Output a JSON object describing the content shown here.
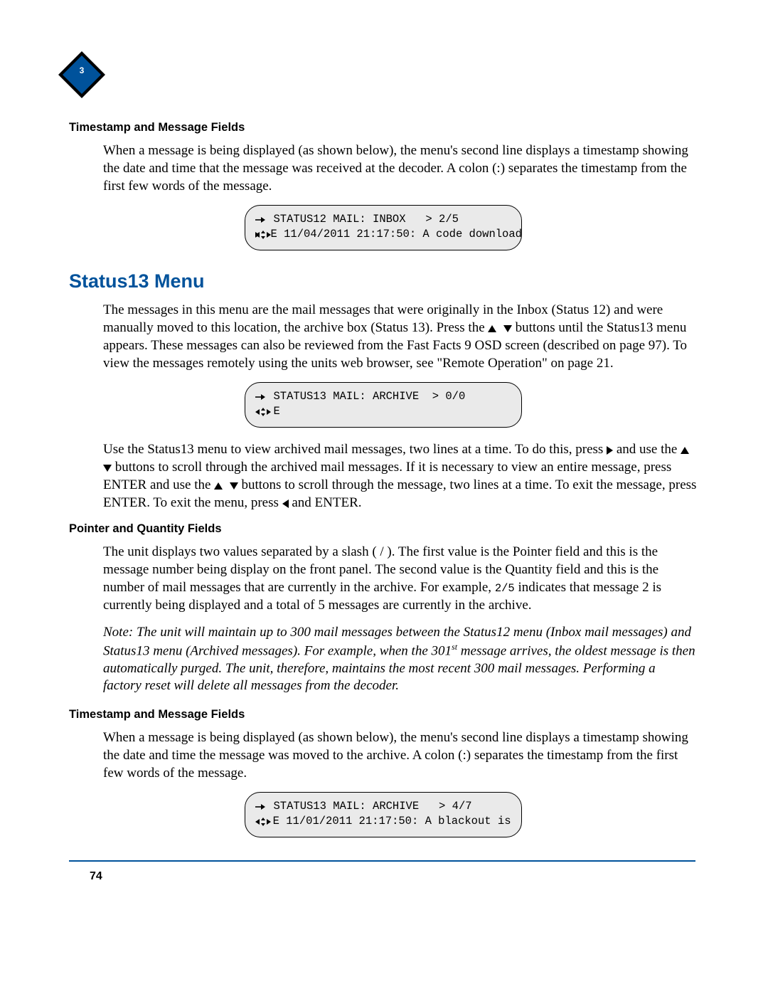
{
  "chapter": "3",
  "sub1": {
    "heading": "Timestamp and Message Fields",
    "para": "When a message is being displayed (as shown below), the menu's second line displays a timestamp showing the date and time that the message was received at the decoder. A colon (:) separates the timestamp from the first few words of the message."
  },
  "panel1": {
    "line1": "STATUS12 MAIL: INBOX   > 2/5",
    "line2": "E 11/04/2011 21:17:50: A code download"
  },
  "section": "Status13 Menu",
  "para_a_pre": "The messages in this menu are the mail messages that were originally in the Inbox (Status 12) and were manually moved to this location, the archive box (Status 13). Press the ",
  "para_a_post": " buttons until the Status13 menu appears. These messages can also be reviewed from the Fast Facts 9 OSD screen (described on page 97). To view the messages remotely using the units web browser, see \"Remote Operation\" on page 21.",
  "panel2": {
    "line1": "STATUS13 MAIL: ARCHIVE  > 0/0",
    "line2": "E"
  },
  "para_b": {
    "p0": "Use the Status13 menu to view archived mail messages, two lines at a time. To do this, press ",
    "p1": " and use the ",
    "p2": " buttons to scroll through the archived mail messages. If it is necessary to view an entire message, press ENTER and use the ",
    "p3": " buttons to scroll through the message, two lines at a time. To exit the message, press ENTER. To exit the menu, press ",
    "p4": " and ENTER."
  },
  "sub2": {
    "heading": "Pointer and Quantity Fields",
    "para_pre": "The unit displays two values separated by a slash ( / ). The first value is the Pointer field and this is the message number being display on the front panel. The second value is the Quantity field and this is the number of mail messages that are currently in the archive. For example, ",
    "code": "2/5",
    "para_post": " indicates that message 2 is currently being displayed and a total of 5 messages are currently in the archive."
  },
  "note": {
    "pre": "Note:  The unit will maintain up to 300 mail messages between the Status12 menu (Inbox mail messages) and Status13 menu (Archived messages). For example, when the 301",
    "sup": "st",
    "post": " message arrives, the oldest message is then automatically purged. The unit, therefore, maintains the most recent 300 mail messages. Performing a factory reset will delete all messages from the decoder."
  },
  "sub3": {
    "heading": "Timestamp and Message Fields",
    "para": "When a message is being displayed (as shown below), the menu's second line displays a timestamp showing the date and time the message was moved to the archive. A colon (:) separates the timestamp from the first few words of the message."
  },
  "panel3": {
    "line1": "STATUS13 MAIL: ARCHIVE   > 4/7",
    "line2": "E 11/01/2011 21:17:50: A blackout is"
  },
  "pageNumber": "74"
}
